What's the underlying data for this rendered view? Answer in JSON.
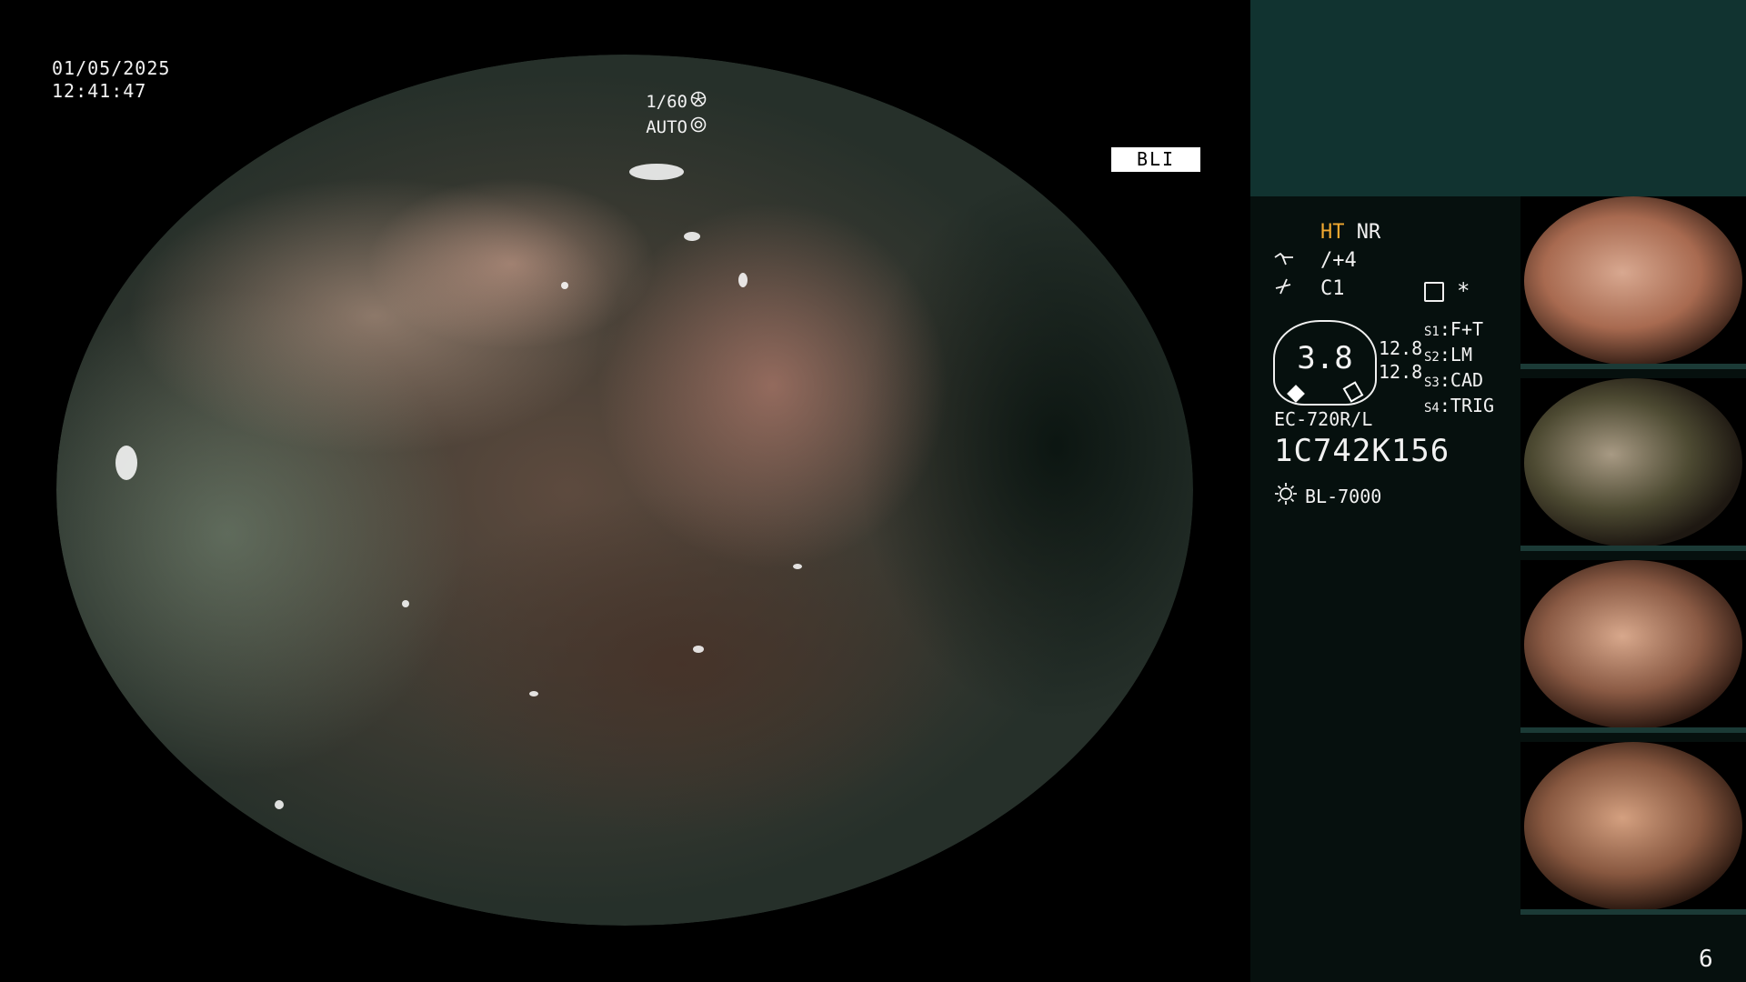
{
  "overlay": {
    "date": "01/05/2025",
    "time": "12:41:47",
    "shutter": "1/60",
    "iris": "AUTO",
    "mode_badge": "BLI"
  },
  "panel": {
    "ht_label": "HT",
    "nr_label": "NR",
    "enhancement": "/+4",
    "color": "C1",
    "star": "*",
    "dial_value": "3.8",
    "dial_side_values": [
      "12.8",
      "12.8"
    ],
    "switches": [
      {
        "key": "S1",
        "value": "F+T"
      },
      {
        "key": "S2",
        "value": "LM"
      },
      {
        "key": "S3",
        "value": "CAD"
      },
      {
        "key": "S4",
        "value": "TRIG"
      }
    ],
    "scope_model": "EC-720R/L",
    "scope_serial": "1C742K156",
    "light_source": "BL-7000",
    "page_number": "6"
  },
  "icons": {
    "shutter": "aperture-icon",
    "iris": "iris-icon",
    "structure": "structure-enhancement-icon",
    "color": "color-enhancement-icon",
    "settings": "menu-settings-icon",
    "light": "light-source-icon"
  },
  "colors": {
    "panel_bg": "#06100e",
    "panel_top_bg": "#113330",
    "ht_accent": "#f0a830"
  }
}
